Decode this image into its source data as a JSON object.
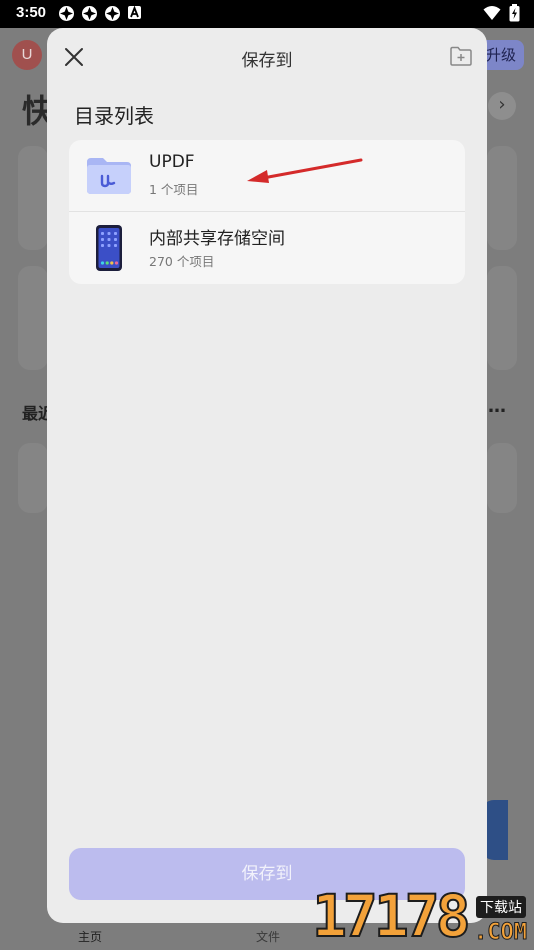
{
  "status_bar": {
    "time": "3:50",
    "left_icons": [
      "sync-icon",
      "sync-icon",
      "sync-icon",
      "font-a-icon"
    ],
    "right_icons": [
      "wifi-icon",
      "battery-charging-icon"
    ]
  },
  "background": {
    "avatar_letter": "U",
    "upgrade_label": "升级",
    "heading_partial": "快",
    "recent_partial": "最近",
    "nav_home": "主页",
    "nav_files": "文件"
  },
  "sheet": {
    "title": "保存到",
    "section_title": "目录列表",
    "folders": [
      {
        "name": "UPDF",
        "count": "1 个项目",
        "icon": "updf-folder-icon"
      },
      {
        "name": "内部共享存储空间",
        "count": "270 个项目",
        "icon": "phone-storage-icon"
      }
    ],
    "save_button_label": "保存到"
  },
  "watermark": {
    "digits": "17178",
    "tag": "下载站",
    "domain": ".COM"
  },
  "colors": {
    "accent": "#7d86c8",
    "save_button": "#bcbcee",
    "arrow": "#d42a2a",
    "watermark": "#f3a23a"
  }
}
